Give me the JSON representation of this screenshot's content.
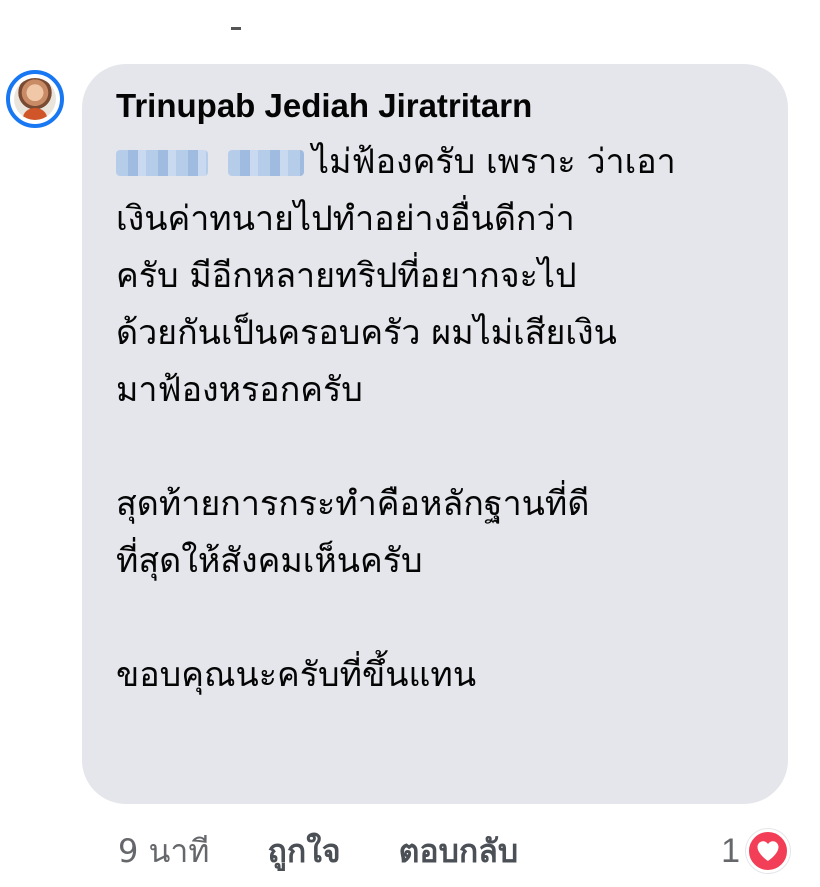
{
  "comment": {
    "author": "Trinupab Jediah Jiratritarn",
    "mention_hidden": "ชื่อที่ถูกเบลอ",
    "lines": [
      "ไม่ฟ้องครับ เพราะ ว่าเอา",
      "เงินค่าทนายไปทำอย่างอื่นดีกว่า",
      "ครับ มีอีกหลายทริปที่อยากจะไป",
      "ด้วยกันเป็นครอบครัว ผมไม่เสียเงิน",
      "มาฟ้องหรอกครับ",
      "",
      "สุดท้ายการกระทำคือหลักฐานที่ดี",
      "ที่สุดให้สังคมเห็นครับ",
      "",
      "ขอบคุณนะครับที่ขึ้นแทน"
    ]
  },
  "actions": {
    "time": "9 นาที",
    "like_label": "ถูกใจ",
    "reply_label": "ตอบกลับ"
  },
  "reaction": {
    "count": "1",
    "icon": "heart-icon",
    "color": "#f33e58"
  },
  "colors": {
    "bubble": "#e4e6eb",
    "avatar_ring": "#1877f2"
  }
}
